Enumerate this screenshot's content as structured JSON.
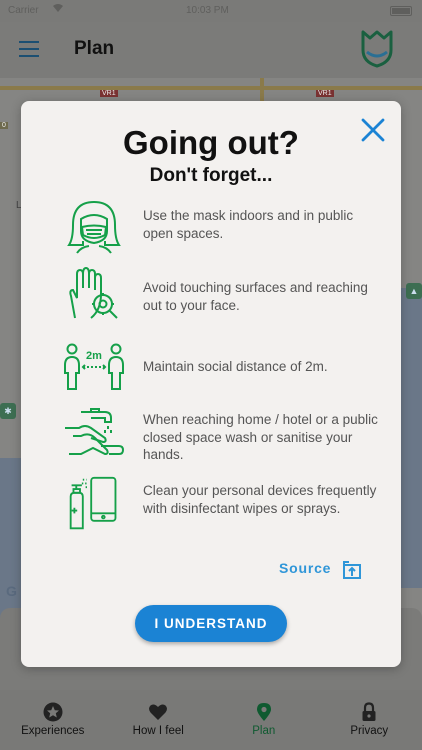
{
  "status_bar": {
    "carrier": "Carrier",
    "time": "10:03 PM"
  },
  "header": {
    "title": "Plan",
    "menu_icon": "hamburger-menu-icon",
    "logo_icon": "shield-logo-icon"
  },
  "map": {
    "watermark": "G",
    "road_badges": [
      "VR1",
      "VR1",
      "0"
    ],
    "corner_label": "L"
  },
  "modal": {
    "title": "Going out?",
    "subtitle": "Don't forget...",
    "close_icon": "close-icon",
    "accent_color": "#15a049",
    "tips": [
      {
        "icon": "face-mask-icon",
        "text": "Use the mask indoors and in public open spaces."
      },
      {
        "icon": "hand-virus-icon",
        "text": "Avoid touching surfaces and reaching out to your face."
      },
      {
        "icon": "social-distance-icon",
        "icon_label": "2m",
        "text": "Maintain social distance of 2m."
      },
      {
        "icon": "hand-washing-icon",
        "text": "When reaching home / hotel or a public closed space wash or sanitise your hands."
      },
      {
        "icon": "device-sanitizer-icon",
        "text": "Clean your personal devices frequently with disinfectant wipes or sprays."
      }
    ],
    "source_label": "Source",
    "source_icon": "open-external-icon",
    "button_label": "I UNDERSTAND",
    "button_color": "#1b83d4"
  },
  "tab_bar": {
    "items": [
      {
        "label": "Experiences",
        "icon": "star-circle-icon",
        "active": false
      },
      {
        "label": "How I feel",
        "icon": "heart-icon",
        "active": false
      },
      {
        "label": "Plan",
        "icon": "map-pin-icon",
        "active": true
      },
      {
        "label": "Privacy",
        "icon": "lock-icon",
        "active": false
      }
    ]
  }
}
